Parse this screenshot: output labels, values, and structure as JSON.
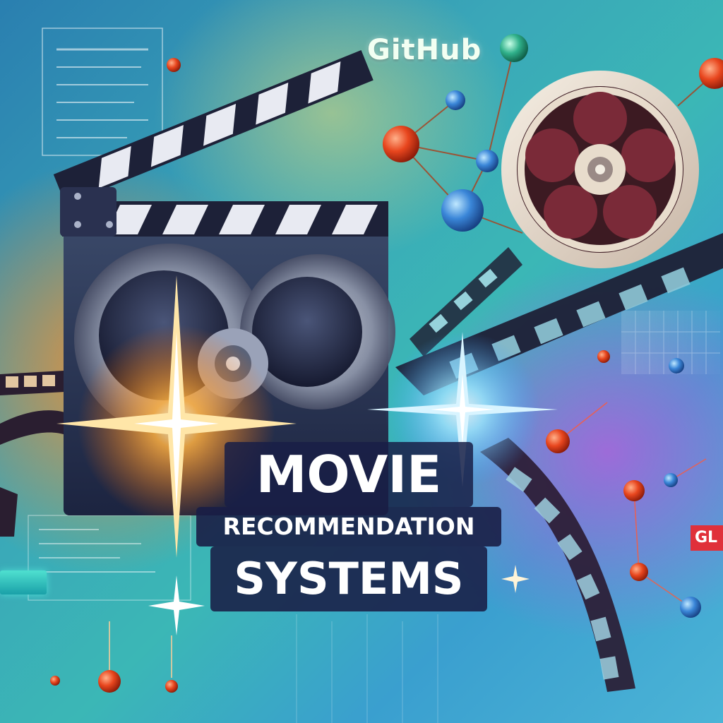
{
  "brand": {
    "label": "GitHub"
  },
  "title": {
    "line1": "MOVIE",
    "line2": "RECOMMENDATION",
    "line3": "SYSTEMS"
  },
  "left_tag": {
    "label": ""
  },
  "right_tag": {
    "label": "GL"
  },
  "colors": {
    "accent_orange": "#ff7a1a",
    "accent_blue": "#5ad2ff",
    "title_bg": "#191e46",
    "node_red": "#e8461e",
    "node_blue": "#3a86d8"
  },
  "icons": [
    "clapperboard-icon",
    "film-reel-icon",
    "filmstrip-icon",
    "network-graph-icon",
    "sparkle-icon"
  ]
}
